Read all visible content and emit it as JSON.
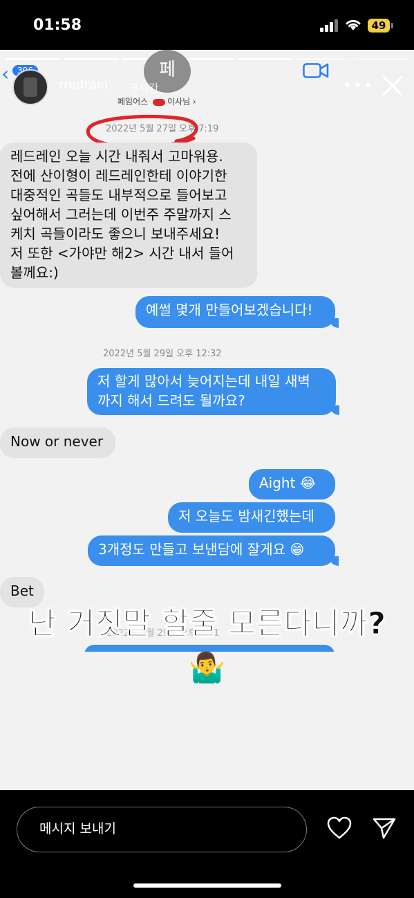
{
  "status_bar": {
    "time": "01:58",
    "battery": "49"
  },
  "dm_header": {
    "unread_count": "396",
    "avatar_initial": "페",
    "subtitle": "페임어스 ",
    "subtitle_end": "이사님 ›"
  },
  "story_header": {
    "username": "rredrain_",
    "time_ago": "3시간"
  },
  "chat": {
    "ts1": "2022년 5월 27일 오후 7:19",
    "msg1_lines": [
      "레드레인 오늘 시간 내줘서 고마워용.",
      "전에 산이형이 레드레인한테 이야기한",
      "대중적인 곡들도 내부적으로 들어보고",
      "싶어해서 그러는데 이번주 주말까지 스",
      "케치 곡들이라도 좋으니 보내주세요!",
      "저 또한 <가야만 해2> 시간 내서 들어",
      "볼께요:)"
    ],
    "msg2": "예썰 몇개 만들어보겠습니다!",
    "ts2": "2022년 5월 29일 오후 12:32",
    "msg3_line1": "저 할게 많아서 늦어지는데 내일 새벽",
    "msg3_line2": "까지 해서 드려도 될까요?",
    "msg4": "Now or never",
    "msg5": "Aight 😂",
    "msg6": "저 오늘도 밤새긴했는데",
    "msg7": "3개정도 만들고 보낸담에 잘게요 😁",
    "msg8": "Bet",
    "ts3": "2022년 5월 29일 오후 3:31"
  },
  "overlay": {
    "caption": "난 거짓말 할줄 모른다니까?",
    "sticker": "🤷‍♂️"
  },
  "bottom_bar": {
    "placeholder": "메시지 보내기"
  },
  "colors": {
    "accent_blue": "#3a8fec",
    "highlight_red": "#e0252a"
  }
}
